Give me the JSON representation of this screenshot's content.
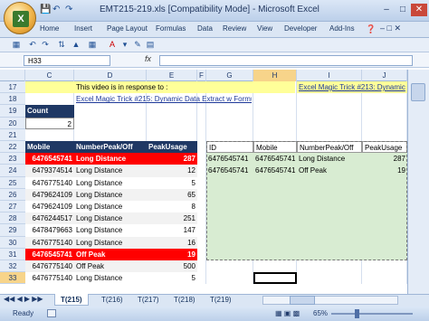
{
  "app": {
    "title": "EMT215-219.xls [Compatibility Mode] - Microsoft Excel",
    "office_button_letter": "X"
  },
  "ribbon": {
    "tabs": [
      "Home",
      "Insert",
      "Page Layout",
      "Formulas",
      "Data",
      "Review",
      "View",
      "Developer",
      "Add-Ins"
    ]
  },
  "formula_bar": {
    "name_box": "H33",
    "fx": "fx",
    "content": ""
  },
  "columns": [
    "C",
    "D",
    "E",
    "F",
    "G",
    "H",
    "I",
    "J"
  ],
  "rows": {
    "17": {
      "D": "This video is in response to :",
      "I": "Excel Magic Trick #213: Dynamic"
    },
    "18": {
      "D": "Excel Magic Trick #215: Dynamic Data Extract w Formula"
    },
    "19": {
      "C": "Count"
    },
    "20": {
      "C": "2"
    },
    "21": {},
    "22": {
      "C": "Mobile",
      "D": "NumberPeak/Off",
      "E": "PeakUsage",
      "G": "ID",
      "H": "Mobile",
      "I": "NumberPeak/Off",
      "J": "PeakUsage"
    }
  },
  "table": [
    {
      "row": "23",
      "mobile": "6476545741",
      "type": "Long Distance",
      "usage": "287",
      "hl": true
    },
    {
      "row": "24",
      "mobile": "6479374514",
      "type": "Long Distance",
      "usage": "12",
      "hl": false
    },
    {
      "row": "25",
      "mobile": "6476775140",
      "type": "Long Distance",
      "usage": "5",
      "hl": false
    },
    {
      "row": "26",
      "mobile": "6479624109",
      "type": "Long Distance",
      "usage": "65",
      "hl": false
    },
    {
      "row": "27",
      "mobile": "6479624109",
      "type": "Long Distance",
      "usage": "8",
      "hl": false
    },
    {
      "row": "28",
      "mobile": "6476244517",
      "type": "Long Distance",
      "usage": "251",
      "hl": false
    },
    {
      "row": "29",
      "mobile": "6478479663",
      "type": "Long Distance",
      "usage": "147",
      "hl": false
    },
    {
      "row": "30",
      "mobile": "6476775140",
      "type": "Long Distance",
      "usage": "16",
      "hl": false
    },
    {
      "row": "31",
      "mobile": "6476545741",
      "type": "Off Peak",
      "usage": "19",
      "hl": true
    },
    {
      "row": "32",
      "mobile": "6476775140",
      "type": "Off Peak",
      "usage": "500",
      "hl": false
    },
    {
      "row": "33",
      "mobile": "6476775140",
      "type": "Long Distance",
      "usage": "5",
      "hl": false
    }
  ],
  "extract": [
    {
      "id": "6476545741",
      "mobile": "6476545741",
      "type": "Long Distance",
      "usage": "287"
    },
    {
      "id": "6476545741",
      "mobile": "6476545741",
      "type": "Off Peak",
      "usage": "19"
    }
  ],
  "sheet_tabs": [
    "T(215)",
    "T(216)",
    "T(217)",
    "T(218)",
    "T(219)"
  ],
  "status": {
    "left": "Ready",
    "zoom": "65%"
  },
  "colors": {
    "header_blue": "#1f3864",
    "highlight_red": "#ff0000",
    "yellow": "#ffff99",
    "green": "#d8ecd2"
  }
}
